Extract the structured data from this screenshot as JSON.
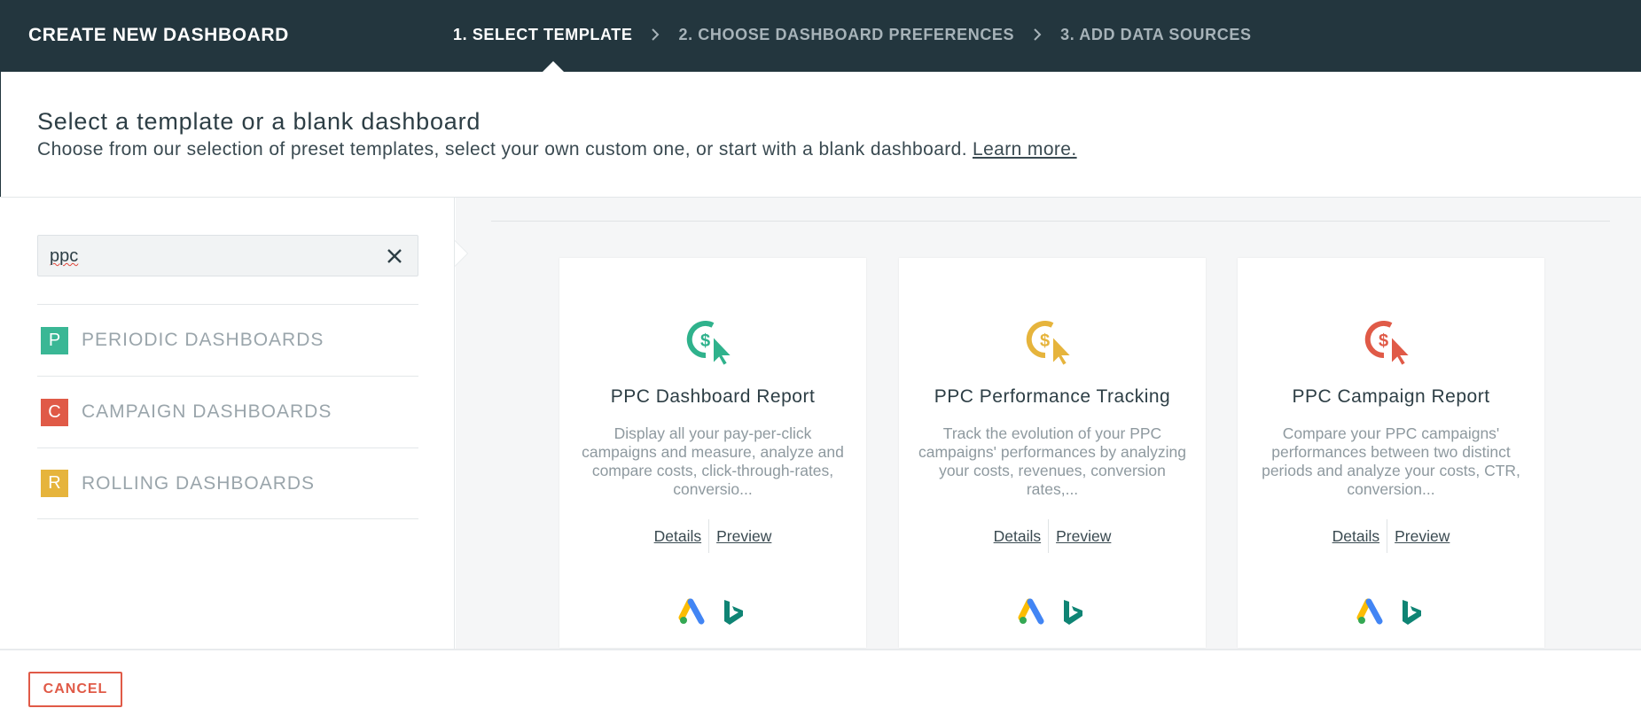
{
  "header": {
    "title": "CREATE NEW DASHBOARD",
    "steps": [
      {
        "label": "1. SELECT TEMPLATE",
        "active": true
      },
      {
        "label": "2. CHOOSE DASHBOARD PREFERENCES",
        "active": false
      },
      {
        "label": "3. ADD DATA SOURCES",
        "active": false
      }
    ]
  },
  "intro": {
    "heading": "Select a template or a blank dashboard",
    "subheading": "Choose from our selection of preset templates, select your own custom one, or start with a blank dashboard.",
    "learn_more": "Learn more."
  },
  "search": {
    "value": "ppc",
    "clear_icon": "close-icon"
  },
  "categories": [
    {
      "badge": "P",
      "label": "PERIODIC DASHBOARDS",
      "color": "#3ab795"
    },
    {
      "badge": "C",
      "label": "CAMPAIGN DASHBOARDS",
      "color": "#e05a47"
    },
    {
      "badge": "R",
      "label": "ROLLING DASHBOARDS",
      "color": "#e6b43c"
    }
  ],
  "cards": [
    {
      "title": "PPC Dashboard Report",
      "description": "Display all your pay-per-click campaigns and measure, analyze and compare costs, click-through-rates, conversio...",
      "details": "Details",
      "preview": "Preview",
      "icon": "ppc-dollar-cursor-icon",
      "icon_color": "#2fb28c"
    },
    {
      "title": "PPC Performance Tracking",
      "description": "Track the evolution of your PPC campaigns' performances by analyzing your costs, revenues, conversion rates,...",
      "details": "Details",
      "preview": "Preview",
      "icon": "ppc-dollar-cursor-icon",
      "icon_color": "#e6b43c"
    },
    {
      "title": "PPC Campaign Report",
      "description": "Compare your PPC campaigns' performances between two distinct periods and analyze your costs, CTR, conversion...",
      "details": "Details",
      "preview": "Preview",
      "icon": "ppc-dollar-cursor-icon",
      "icon_color": "#e05a47"
    }
  ],
  "footer": {
    "cancel_label": "CANCEL"
  },
  "colors": {
    "topbar": "#23363e",
    "accent_red": "#e05a47"
  }
}
